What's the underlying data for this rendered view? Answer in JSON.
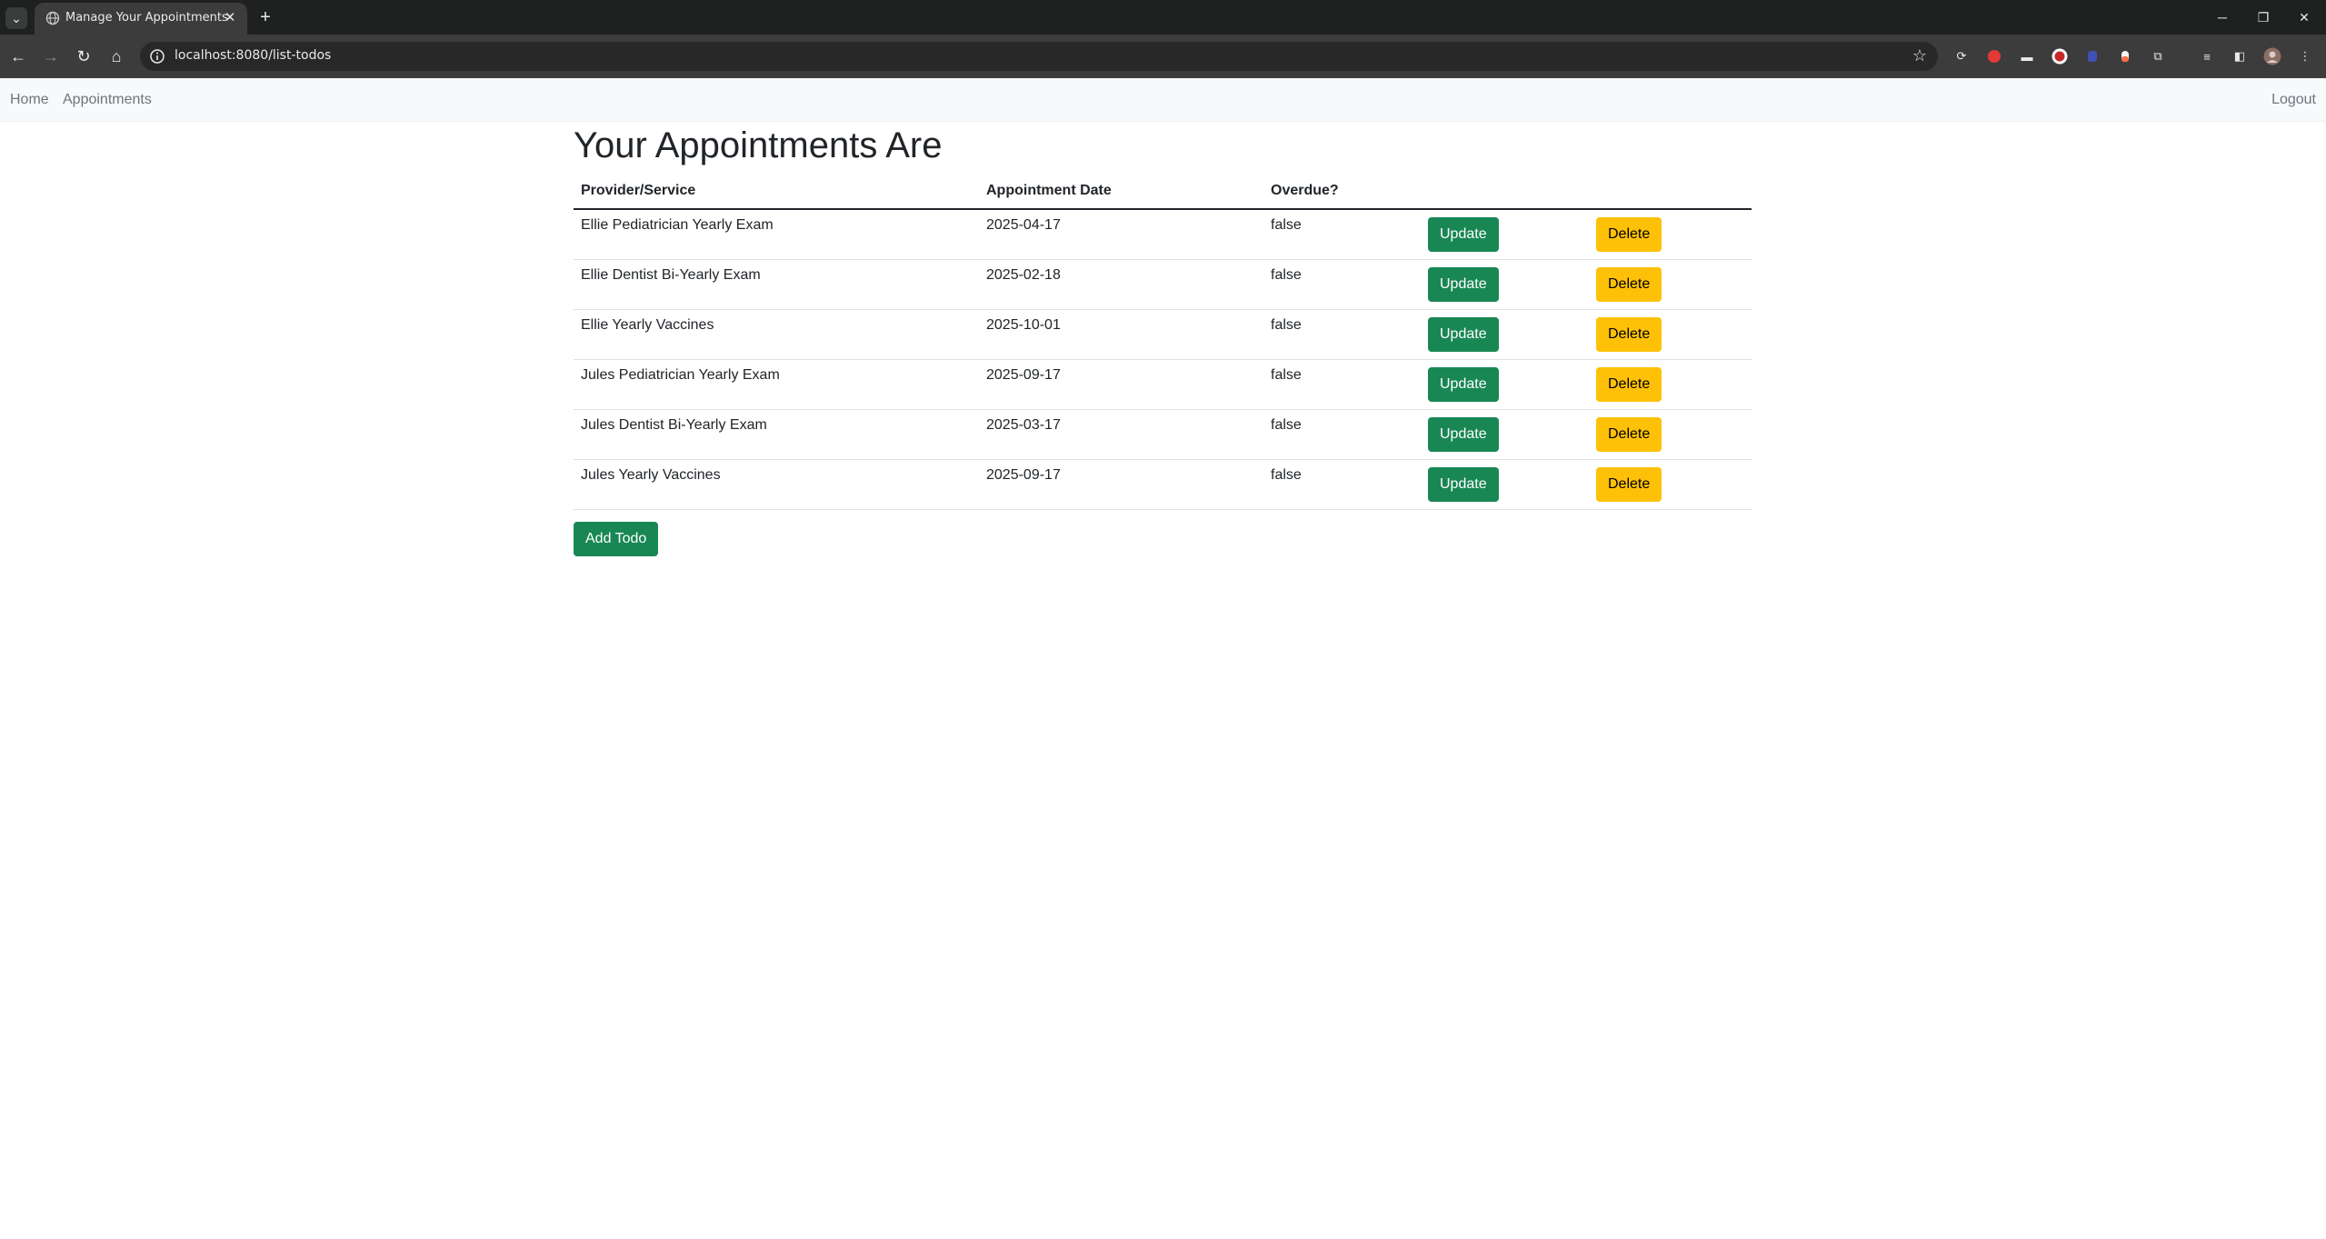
{
  "browser": {
    "tab_title": "Manage Your Appointments",
    "url": "localhost:8080/list-todos"
  },
  "navbar": {
    "home": "Home",
    "appointments": "Appointments",
    "logout": "Logout"
  },
  "page": {
    "title": "Your Appointments Are",
    "columns": [
      "Provider/Service",
      "Appointment Date",
      "Overdue?"
    ],
    "update_label": "Update",
    "delete_label": "Delete",
    "add_label": "Add Todo",
    "rows": [
      {
        "service": "Ellie Pediatrician Yearly Exam",
        "date": "2025-04-17",
        "overdue": "false"
      },
      {
        "service": "Ellie Dentist Bi-Yearly Exam",
        "date": "2025-02-18",
        "overdue": "false"
      },
      {
        "service": "Ellie Yearly Vaccines",
        "date": "2025-10-01",
        "overdue": "false"
      },
      {
        "service": "Jules Pediatrician Yearly Exam",
        "date": "2025-09-17",
        "overdue": "false"
      },
      {
        "service": "Jules Dentist Bi-Yearly Exam",
        "date": "2025-03-17",
        "overdue": "false"
      },
      {
        "service": "Jules Yearly Vaccines",
        "date": "2025-09-17",
        "overdue": "false"
      }
    ]
  },
  "colors": {
    "success": "#198754",
    "warning": "#ffc107",
    "navbar_bg": "#f8f9fa"
  }
}
